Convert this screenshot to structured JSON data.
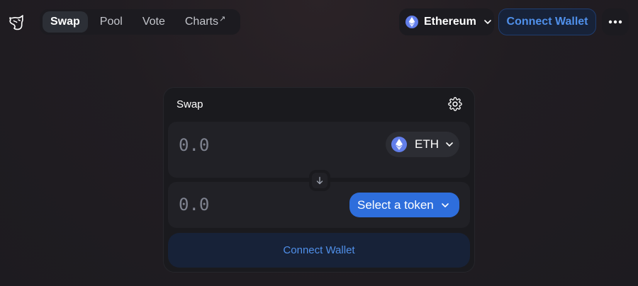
{
  "header": {
    "logo_icon": "uniswap-unicorn-icon",
    "nav": [
      {
        "label": "Swap",
        "active": true
      },
      {
        "label": "Pool",
        "active": false
      },
      {
        "label": "Vote",
        "active": false
      },
      {
        "label": "Charts",
        "external_arrow": "↗",
        "active": false
      }
    ],
    "network": {
      "label": "Ethereum",
      "icon": "ethereum-icon"
    },
    "connect_label": "Connect Wallet",
    "more_icon": "more-dots-icon"
  },
  "swap": {
    "title": "Swap",
    "settings_icon": "gear-icon",
    "input": {
      "placeholder": "0.0",
      "token": "ETH",
      "token_icon": "ethereum-icon"
    },
    "output": {
      "placeholder": "0.0",
      "select_label": "Select a token"
    },
    "switch_icon": "arrow-down-icon",
    "connect_label": "Connect Wallet"
  },
  "colors": {
    "accent": "#2e6edc",
    "connect_text": "#5090ea",
    "connect_bg": "#172238",
    "eth_icon": "#627eea"
  }
}
